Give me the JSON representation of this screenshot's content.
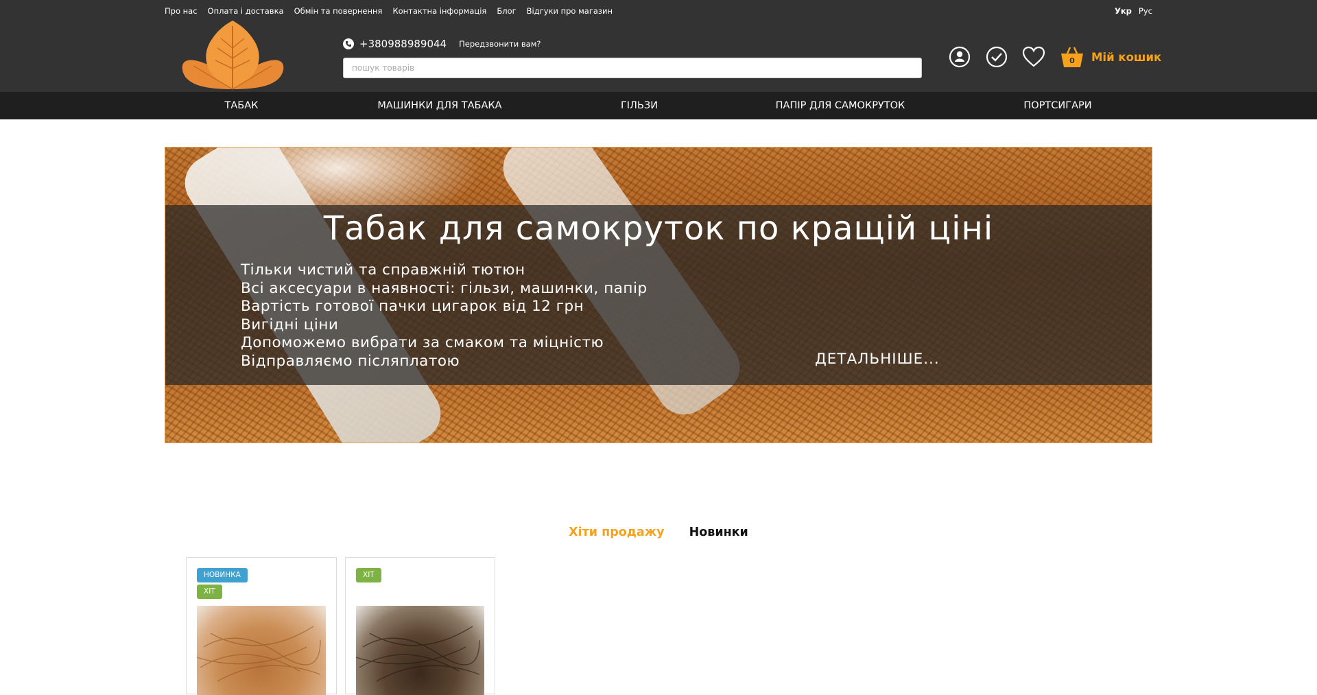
{
  "top_links": [
    "Про нас",
    "Оплата і доставка",
    "Обмін та повернення",
    "Контактна інформація",
    "Блог",
    "Відгуки про магазин"
  ],
  "languages": {
    "ukr": "Укр",
    "rus": "Рус"
  },
  "header": {
    "phone": "+380988989044",
    "callback": "Передзвонити вам?",
    "search_placeholder": "пошук товарів",
    "cart_label": "Мій кошик",
    "cart_count": "0"
  },
  "icons": [
    "account-icon",
    "compare-icon",
    "wishlist-heart-icon",
    "cart-basket-icon",
    "phone-icon",
    "tobacco-leaf-logo"
  ],
  "nav": [
    "ТАБАК",
    "МАШИНКИ ДЛЯ ТАБАКА",
    "ГІЛЬЗИ",
    "ПАПІР ДЛЯ САМОКРУТОК",
    "ПОРТСИГАРИ"
  ],
  "banner": {
    "title": "Табак для самокруток по кращій ціні",
    "lines": [
      "Тільки чистий та справжній тютюн",
      "Всі аксесуари в наявності: гільзи, машинки, папір",
      "Вартість готової пачки цигарок від 12 грн",
      "Вигідні ціни",
      "Допоможемо вибрати за смаком та міцністю",
      "Відправляємо післяплатою"
    ],
    "more": "ДЕТАЛЬНІШЕ..."
  },
  "tabs": {
    "hits": "Хіти продажу",
    "new": "Новинки"
  },
  "products": [
    {
      "badges": [
        "НОВИНКА",
        "ХІТ"
      ]
    },
    {
      "badges": [
        "ХІТ"
      ]
    }
  ],
  "colors": {
    "accent": "#f7a21b",
    "topbar": "#333333",
    "nav": "#1f1f1f",
    "badge_new": "#3ea1cf",
    "badge_hit": "#7cb342"
  }
}
